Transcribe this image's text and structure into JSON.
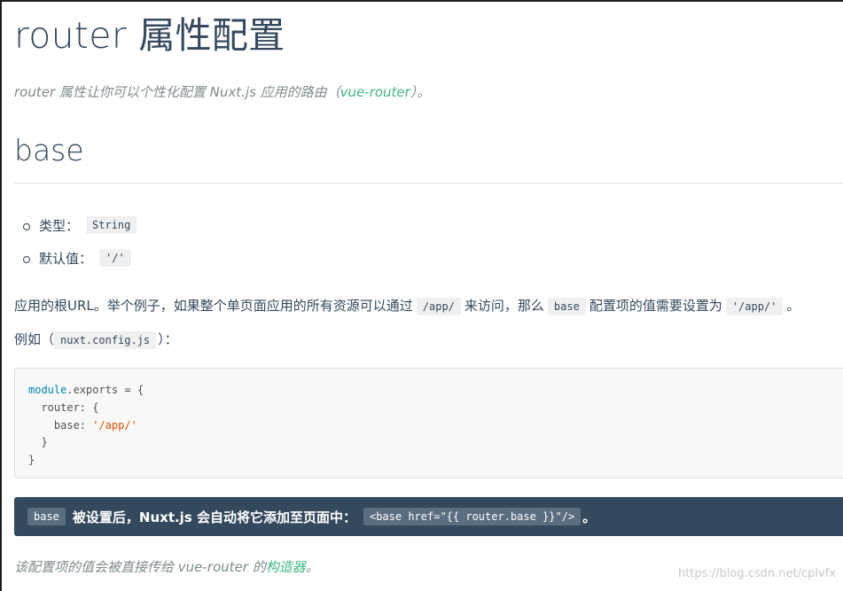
{
  "title": "router 属性配置",
  "intro": {
    "before": "router 属性让你可以个性化配置 Nuxt.js 应用的路由（",
    "link": "vue-router",
    "after": "）。"
  },
  "section_heading": "base",
  "props": [
    {
      "label": "类型：",
      "value": "String"
    },
    {
      "label": "默认值：",
      "value": "'/'"
    }
  ],
  "desc": {
    "part1": "应用的根URL。举个例子，如果整个单页面应用的所有资源可以通过",
    "code1": "/app/",
    "part2": "来访问，那么",
    "code2": "base",
    "part3": "配置项的值需要设置为",
    "code3": "'/app/'",
    "part4": "。"
  },
  "example": {
    "prefix": "例如（",
    "file": "nuxt.config.js",
    "suffix": "）："
  },
  "code_lines": {
    "l1_kw": "module",
    "l1_rest": ".exports = {",
    "l2": "  router: {",
    "l3_key": "    base: ",
    "l3_str": "'/app/'",
    "l4": "  }",
    "l5": "}"
  },
  "tip": {
    "code1": "base",
    "text": "被设置后，Nuxt.js 会自动将它添加至页面中：",
    "code2": "<base href=\"{{ router.base }}\"/>",
    "end": "。"
  },
  "footnote": {
    "before": "该配置项的值会被直接传给 vue-router 的",
    "link": "构造器",
    "after": "。"
  },
  "watermark": "https://blog.csdn.net/cplvfx",
  "colors": {
    "accent": "#41b883",
    "text": "#34495e",
    "tip_bg": "#34495e"
  }
}
